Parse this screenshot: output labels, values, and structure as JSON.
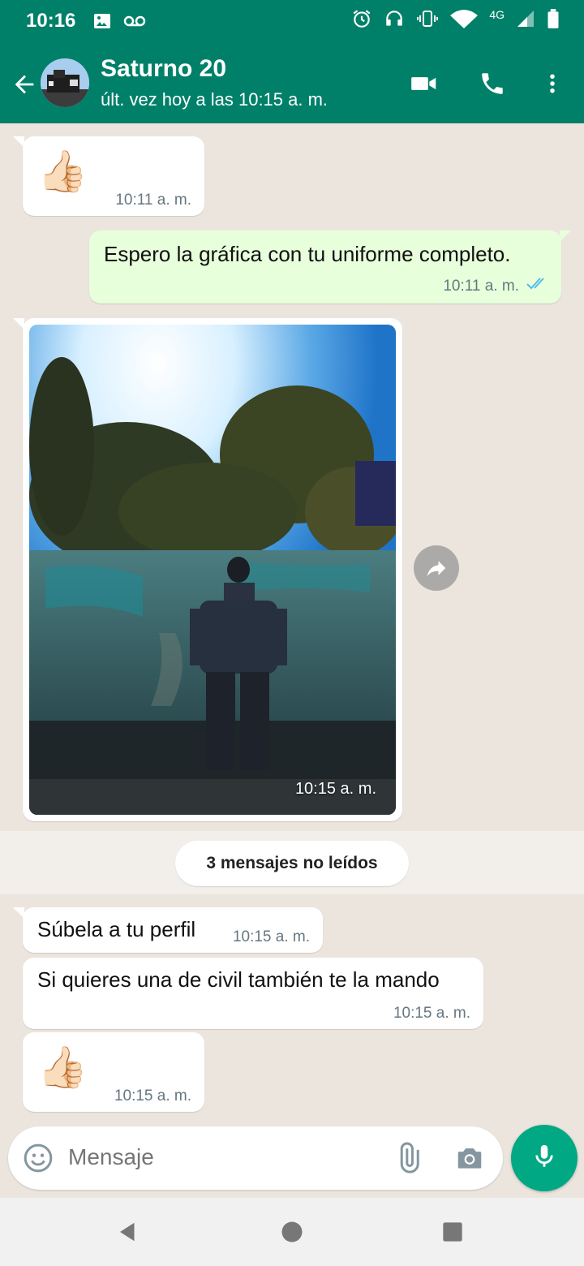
{
  "status_bar": {
    "time": "10:16",
    "network": "4G",
    "icons": [
      "image-icon",
      "voicemail-icon",
      "alarm-icon",
      "headset-icon",
      "vibrate-icon",
      "wifi-icon",
      "signal-icon",
      "battery-icon"
    ]
  },
  "header": {
    "contact_name": "Saturno 20",
    "last_seen": "últ. vez hoy a las 10:15 a. m.",
    "icons": [
      "back-arrow-icon",
      "video-call-icon",
      "phone-icon",
      "more-vert-icon"
    ]
  },
  "messages": [
    {
      "direction": "in",
      "type": "emoji",
      "emoji": "👍🏻",
      "time": "10:11 a. m."
    },
    {
      "direction": "out",
      "type": "text",
      "text": "Espero la gráfica con tu uniforme completo.",
      "time": "10:11 a. m.",
      "status": "read"
    },
    {
      "direction": "in",
      "type": "image",
      "time": "10:15 a. m."
    },
    {
      "direction": "in",
      "type": "text",
      "text": "Súbela a tu perfil",
      "time": "10:15 a. m."
    },
    {
      "direction": "in",
      "type": "text",
      "text": "Si quieres una de civil también te la mando",
      "time": "10:15 a. m."
    },
    {
      "direction": "in",
      "type": "emoji",
      "emoji": "👍🏻",
      "time": "10:15 a. m."
    }
  ],
  "unread_banner": "3 mensajes no leídos",
  "input": {
    "placeholder": "Mensaje",
    "icons": [
      "emoji-icon",
      "attach-icon",
      "camera-icon",
      "mic-icon"
    ]
  },
  "colors": {
    "header": "#008069",
    "accent": "#00a884",
    "chat_background": "#ece5dd",
    "outgoing_bubble": "#e7ffdb",
    "read_ticks": "#53bdeb"
  }
}
